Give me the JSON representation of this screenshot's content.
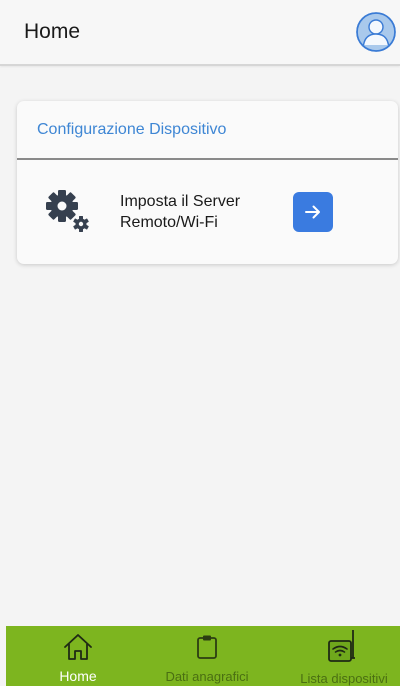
{
  "header": {
    "title": "Home",
    "avatar_icon": "user-avatar-icon"
  },
  "card": {
    "title": "Configurazione Dispositivo",
    "item": {
      "icon": "gears-icon",
      "label": "Imposta il Server Remoto/Wi-Fi",
      "action_icon": "arrow-right-icon"
    }
  },
  "bottom_nav": {
    "items": [
      {
        "label": "Home",
        "icon": "house-icon",
        "active": true
      },
      {
        "label": "Dati anagrafici",
        "icon": "clipboard-icon",
        "active": false
      },
      {
        "label": "Lista dispositivi",
        "icon": "router-wifi-icon",
        "active": false
      }
    ]
  },
  "colors": {
    "accent": "#3e86d4",
    "button": "#3a7be0",
    "nav_background": "#7db51f",
    "nav_inactive_text": "#4a6f12"
  }
}
